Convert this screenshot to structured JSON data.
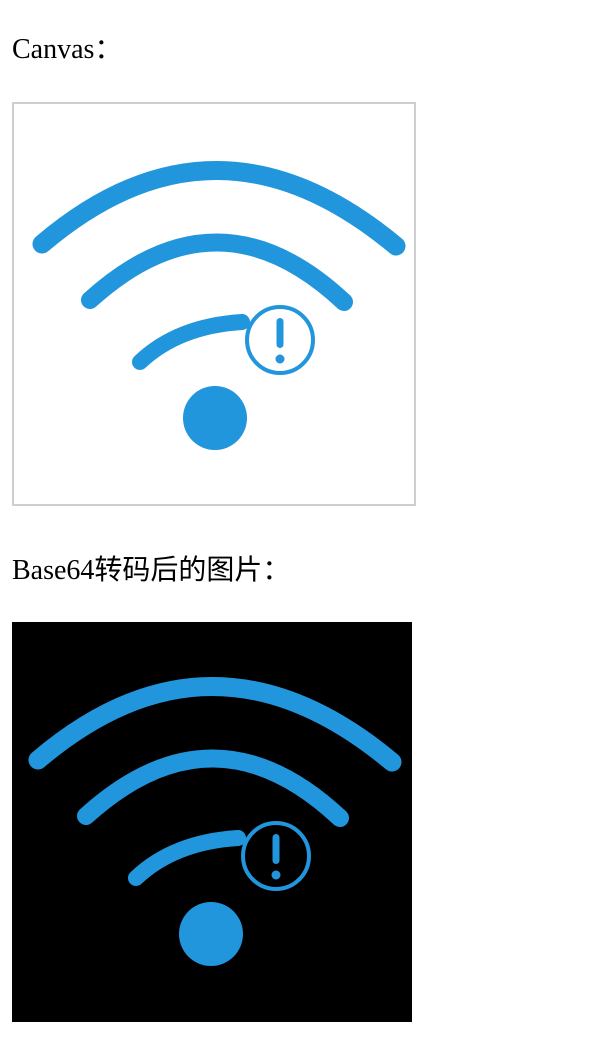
{
  "labels": {
    "canvas": "Canvas：",
    "base64_image": "Base64转码后的图片："
  },
  "icons": {
    "canvas_icon": "wifi-warning-icon",
    "image_icon": "wifi-warning-icon"
  },
  "colors": {
    "icon_blue": "#2196dc",
    "canvas_background": "#ffffff",
    "canvas_border": "#cfcfcf",
    "image_background": "#000000"
  }
}
